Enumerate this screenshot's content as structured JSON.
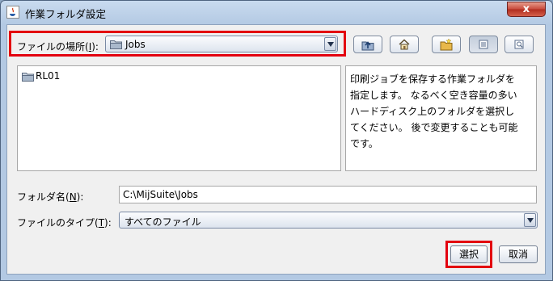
{
  "window": {
    "title": "作業フォルダ設定",
    "close_symbol": "x"
  },
  "look_in": {
    "label": "ファイルの場所(I):",
    "value": "Jobs"
  },
  "toolbar": [
    "up-one-level",
    "home",
    "new-folder",
    "list-view",
    "details-view"
  ],
  "file_list": [
    {
      "name": "RL01",
      "type": "folder"
    }
  ],
  "description": "印刷ジョブを保存する作業フォルダを指定します。 なるべく空き容量の多いハードディスク上のフォルダを選択してください。 後で変更することも可能です。",
  "folder_name": {
    "label": "フォルダ名(N):",
    "value": "C:\\MijSuite\\Jobs"
  },
  "file_type": {
    "label": "ファイルのタイプ(T):",
    "value": "すべてのファイル"
  },
  "buttons": {
    "select": "選択",
    "cancel": "取消"
  },
  "colors": {
    "highlight": "#e3000f",
    "titlebar": "#b3c9e3"
  }
}
